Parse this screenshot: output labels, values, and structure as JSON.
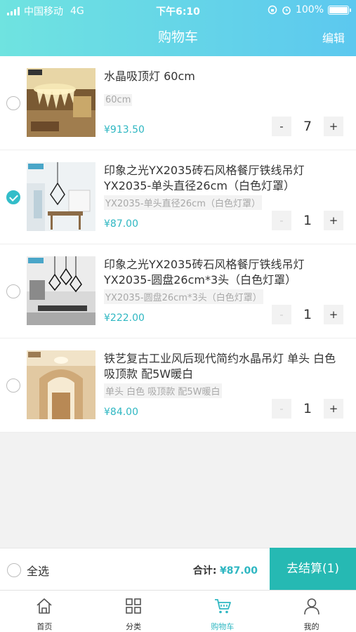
{
  "status_bar": {
    "carrier": "中国移动",
    "network": "4G",
    "time": "下午6:10",
    "battery": "100%"
  },
  "header": {
    "title": "购物车",
    "edit_label": "编辑"
  },
  "cart_items": [
    {
      "name": "水晶吸顶灯 60cm",
      "spec": "60cm",
      "price": "¥913.50",
      "quantity": "7",
      "minus": "-",
      "plus": "+",
      "checked": false
    },
    {
      "name": "印象之光YX2035砖石风格餐厅铁线吊灯 YX2035-单头直径26cm（白色灯罩）",
      "spec": "YX2035-单头直径26cm（白色灯罩）",
      "price": "¥87.00",
      "quantity": "1",
      "minus": "-",
      "plus": "+",
      "checked": true
    },
    {
      "name": "印象之光YX2035砖石风格餐厅铁线吊灯 YX2035-圆盘26cm*3头（白色灯罩）",
      "spec": "YX2035-圆盘26cm*3头（白色灯罩）",
      "price": "¥222.00",
      "quantity": "1",
      "minus": "-",
      "plus": "+",
      "checked": false
    },
    {
      "name": "铁艺复古工业风后现代简约水晶吊灯 单头 白色 吸顶款 配5W暖白",
      "spec": "单头 白色 吸顶款 配5W暖白",
      "price": "¥84.00",
      "quantity": "1",
      "minus": "-",
      "plus": "+",
      "checked": false
    }
  ],
  "checkout": {
    "select_all_label": "全选",
    "total_label": "合计:",
    "total_value": "¥87.00",
    "checkout_label": "去结算(1)"
  },
  "tabbar": {
    "items": [
      {
        "label": "首页",
        "icon": "home-icon"
      },
      {
        "label": "分类",
        "icon": "grid-icon"
      },
      {
        "label": "购物车",
        "icon": "cart-icon",
        "active": true
      },
      {
        "label": "我的",
        "icon": "user-icon"
      }
    ],
    "active_color": "#2fb7c2"
  },
  "colors": {
    "accent": "#2fb7c2",
    "checkout_button": "#26b9b3",
    "header_gradient_start": "#6fe3e0",
    "header_gradient_end": "#5cc8ef"
  }
}
